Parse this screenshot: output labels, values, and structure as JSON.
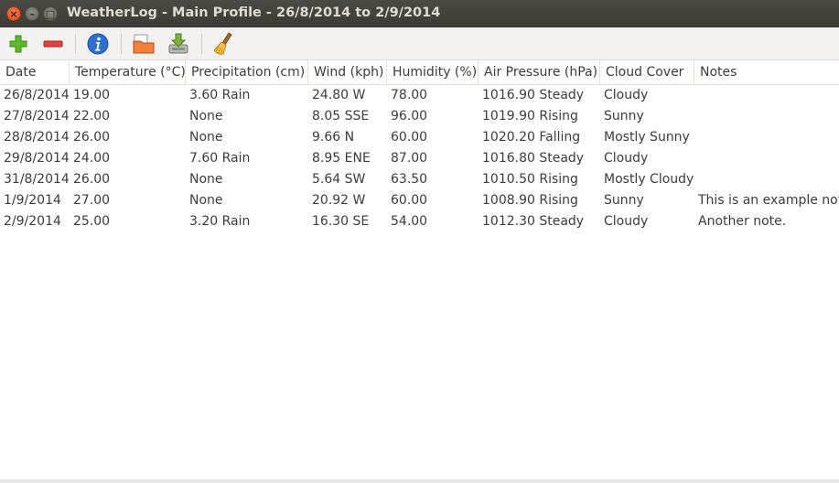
{
  "window": {
    "title": "WeatherLog - Main Profile - 26/8/2014 to 2/9/2014",
    "close_glyph": "×",
    "min_glyph": "–",
    "max_glyph": "□"
  },
  "toolbar": {
    "buttons": [
      {
        "name": "add-icon",
        "color": "#4caf1e"
      },
      {
        "name": "remove-icon",
        "color": "#d9302c"
      },
      {
        "name": "info-icon",
        "color": "#2a6dcc"
      },
      {
        "name": "import-icon",
        "color": "#e8632a"
      },
      {
        "name": "export-icon",
        "color": "#7aa83a"
      },
      {
        "name": "clear-icon",
        "color": "#e3a93a"
      }
    ]
  },
  "table": {
    "columns": [
      "Date",
      "Temperature (°C)",
      "Precipitation (cm)",
      "Wind (kph)",
      "Humidity (%)",
      "Air Pressure (hPa)",
      "Cloud Cover",
      "Notes"
    ],
    "rows": [
      [
        "26/8/2014",
        "19.00",
        "3.60 Rain",
        "24.80 W",
        "78.00",
        "1016.90 Steady",
        "Cloudy",
        ""
      ],
      [
        "27/8/2014",
        "22.00",
        "None",
        "8.05 SSE",
        "96.00",
        "1019.90 Rising",
        "Sunny",
        ""
      ],
      [
        "28/8/2014",
        "26.00",
        "None",
        "9.66 N",
        "60.00",
        "1020.20 Falling",
        "Mostly Sunny",
        ""
      ],
      [
        "29/8/2014",
        "24.00",
        "7.60 Rain",
        "8.95 ENE",
        "87.00",
        "1016.80 Steady",
        "Cloudy",
        ""
      ],
      [
        "31/8/2014",
        "26.00",
        "None",
        "5.64 SW",
        "63.50",
        "1010.50 Rising",
        "Mostly Cloudy",
        ""
      ],
      [
        "1/9/2014",
        "27.00",
        "None",
        "20.92 W",
        "60.00",
        "1008.90 Rising",
        "Sunny",
        "This is an example note."
      ],
      [
        "2/9/2014",
        "25.00",
        "3.20 Rain",
        "16.30 SE",
        "54.00",
        "1012.30 Steady",
        "Cloudy",
        "Another note."
      ]
    ]
  }
}
